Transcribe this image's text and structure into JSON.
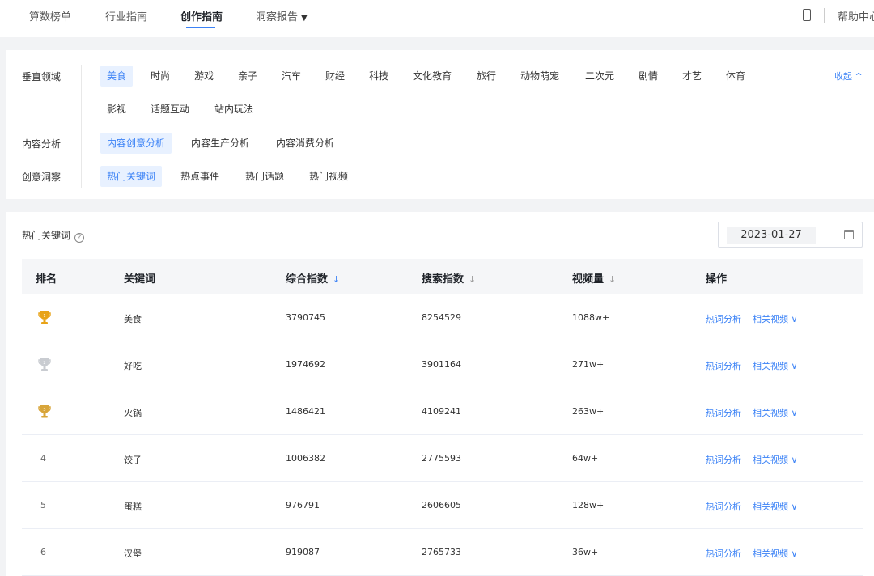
{
  "nav": {
    "items": [
      "算数榜单",
      "行业指南",
      "创作指南",
      "洞察报告"
    ],
    "active_index": 2,
    "help_label": "帮助中心"
  },
  "filters": {
    "vertical_label": "垂直领域",
    "vertical_items": [
      "美食",
      "时尚",
      "游戏",
      "亲子",
      "汽车",
      "财经",
      "科技",
      "文化教育",
      "旅行",
      "动物萌宠",
      "二次元",
      "剧情",
      "才艺",
      "体育",
      "影视",
      "话题互动",
      "站内玩法"
    ],
    "content_label": "内容分析",
    "content_items": [
      "内容创意分析",
      "内容生产分析",
      "内容消费分析"
    ],
    "insight_label": "创意洞察",
    "insight_items": [
      "热门关键词",
      "热点事件",
      "热门话题",
      "热门视频"
    ],
    "collapse_label": "收起 ^"
  },
  "section": {
    "title": "热门关键词",
    "help_glyph": "?",
    "date": "2023-01-27"
  },
  "table": {
    "headers": {
      "rank": "排名",
      "keyword": "关键词",
      "composite": "综合指数",
      "search": "搜索指数",
      "videos": "视频量",
      "ops": "操作"
    },
    "sort_arrow": "↓",
    "op_analysis": "热词分析",
    "op_related": "相关视频 ∨",
    "rows": [
      {
        "rank": "1",
        "keyword": "美食",
        "composite": "3790745",
        "search": "8254529",
        "videos": "1088w+"
      },
      {
        "rank": "2",
        "keyword": "好吃",
        "composite": "1974692",
        "search": "3901164",
        "videos": "271w+"
      },
      {
        "rank": "3",
        "keyword": "火锅",
        "composite": "1486421",
        "search": "4109241",
        "videos": "263w+"
      },
      {
        "rank": "4",
        "keyword": "饺子",
        "composite": "1006382",
        "search": "2775593",
        "videos": "64w+"
      },
      {
        "rank": "5",
        "keyword": "蛋糕",
        "composite": "976791",
        "search": "2606605",
        "videos": "128w+"
      },
      {
        "rank": "6",
        "keyword": "汉堡",
        "composite": "919087",
        "search": "2765733",
        "videos": "36w+"
      }
    ]
  },
  "colors": {
    "accent": "#3b82f6",
    "gold": "#e8a317",
    "silver": "#c9ccd1",
    "bronze": "#d8a53a"
  }
}
